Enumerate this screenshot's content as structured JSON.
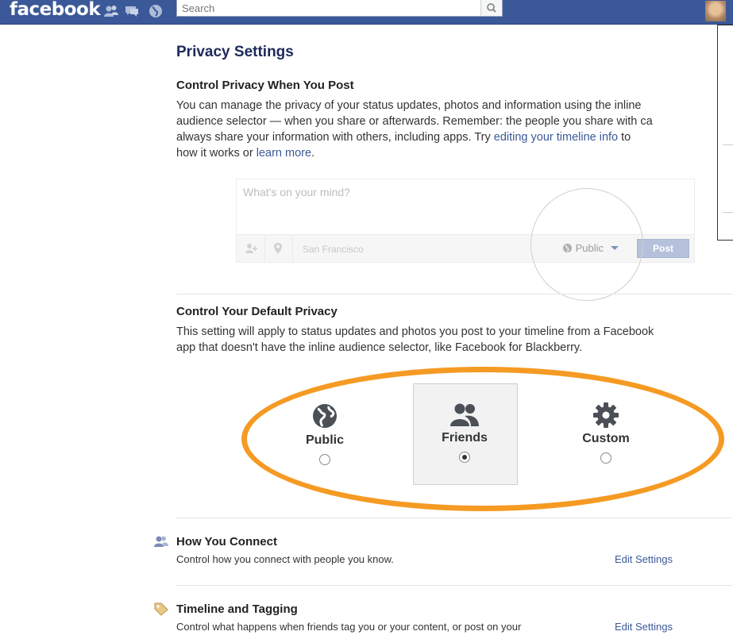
{
  "topbar": {
    "logo": "facebook",
    "search_placeholder": "Search"
  },
  "page": {
    "title": "Privacy Settings"
  },
  "post_privacy": {
    "heading": "Control Privacy When You Post",
    "line1": "You can manage the privacy of your status updates, photos and information using the inline",
    "line2": "audience selector — when you share or afterwards. Remember: the people you share with ca",
    "line3_prefix": "always share your information with others, including apps. Try ",
    "line3_link": "editing your timeline info",
    "line3_suffix": " to",
    "line4_prefix": "how it works or ",
    "line4_link": "learn more",
    "line4_suffix": "."
  },
  "composer": {
    "placeholder": "What's on your mind?",
    "location": "San Francisco",
    "audience": "Public",
    "post_label": "Post"
  },
  "default_privacy": {
    "heading": "Control Your Default Privacy",
    "line1": "This setting will apply to status updates and photos you post to your timeline from a Facebook",
    "line2": "app that doesn't have the inline audience selector, like Facebook for Blackberry.",
    "options": [
      {
        "label": "Public",
        "selected": false
      },
      {
        "label": "Friends",
        "selected": true
      },
      {
        "label": "Custom",
        "selected": false
      }
    ]
  },
  "sections": [
    {
      "title": "How You Connect",
      "desc": "Control how you connect with people you know.",
      "edit": "Edit Settings"
    },
    {
      "title": "Timeline and Tagging",
      "desc": "Control what happens when friends tag you or your content, or post on your",
      "edit": "Edit Settings"
    }
  ],
  "colors": {
    "brand": "#3b5998",
    "highlight": "#f59a23"
  }
}
